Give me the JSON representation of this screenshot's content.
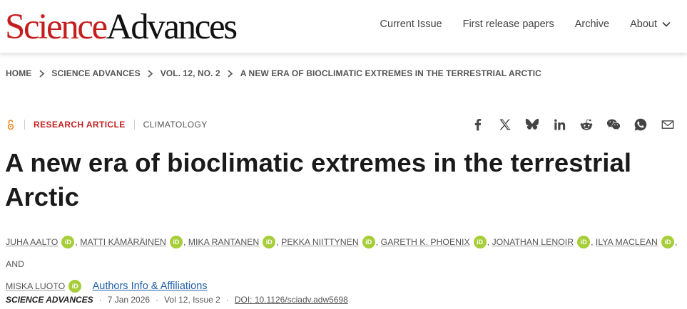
{
  "header": {
    "logo_part1": "Science",
    "logo_part2": "Advances",
    "nav": [
      {
        "label": "Current Issue"
      },
      {
        "label": "First release papers"
      },
      {
        "label": "Archive"
      },
      {
        "label": "About",
        "icon": "chevron-down-icon"
      }
    ]
  },
  "breadcrumb": {
    "items": [
      "HOME",
      "SCIENCE ADVANCES",
      "VOL. 12, NO. 2",
      "A NEW ERA OF BIOCLIMATIC EXTREMES IN THE TERRESTRIAL ARCTIC"
    ]
  },
  "article": {
    "access_icon": "open-access-icon",
    "type": "RESEARCH ARTICLE",
    "subject": "CLIMATOLOGY",
    "title": "A new era of bioclimatic extremes in the terrestrial Arctic",
    "authors": [
      "JUHA AALTO",
      "MATTI KÄMÄRÄINEN",
      "MIKA RANTANEN",
      "PEKKA NIITTYNEN",
      "GARETH K. PHOENIX",
      "JONATHAN LENOIR",
      "ILYA MACLEAN",
      "MISKA LUOTO"
    ],
    "orcid_label": "iD",
    "author_separator": ",",
    "author_and": ", AND",
    "affiliations_link": "Authors Info & Affiliations",
    "journal": "SCIENCE ADVANCES",
    "date": "7 Jan 2026",
    "volume_issue": "Vol 12, Issue 2",
    "doi": "DOI: 10.1126/sciadv.adw5698"
  },
  "share_icons": [
    "facebook-icon",
    "x-twitter-icon",
    "bluesky-icon",
    "linkedin-icon",
    "reddit-icon",
    "wechat-icon",
    "whatsapp-icon",
    "email-icon"
  ],
  "colors": {
    "brand_red": "#c41e1e",
    "orcid_green": "#a6ce39",
    "link_blue": "#1f5fa8",
    "open_access_orange": "#f68212"
  }
}
